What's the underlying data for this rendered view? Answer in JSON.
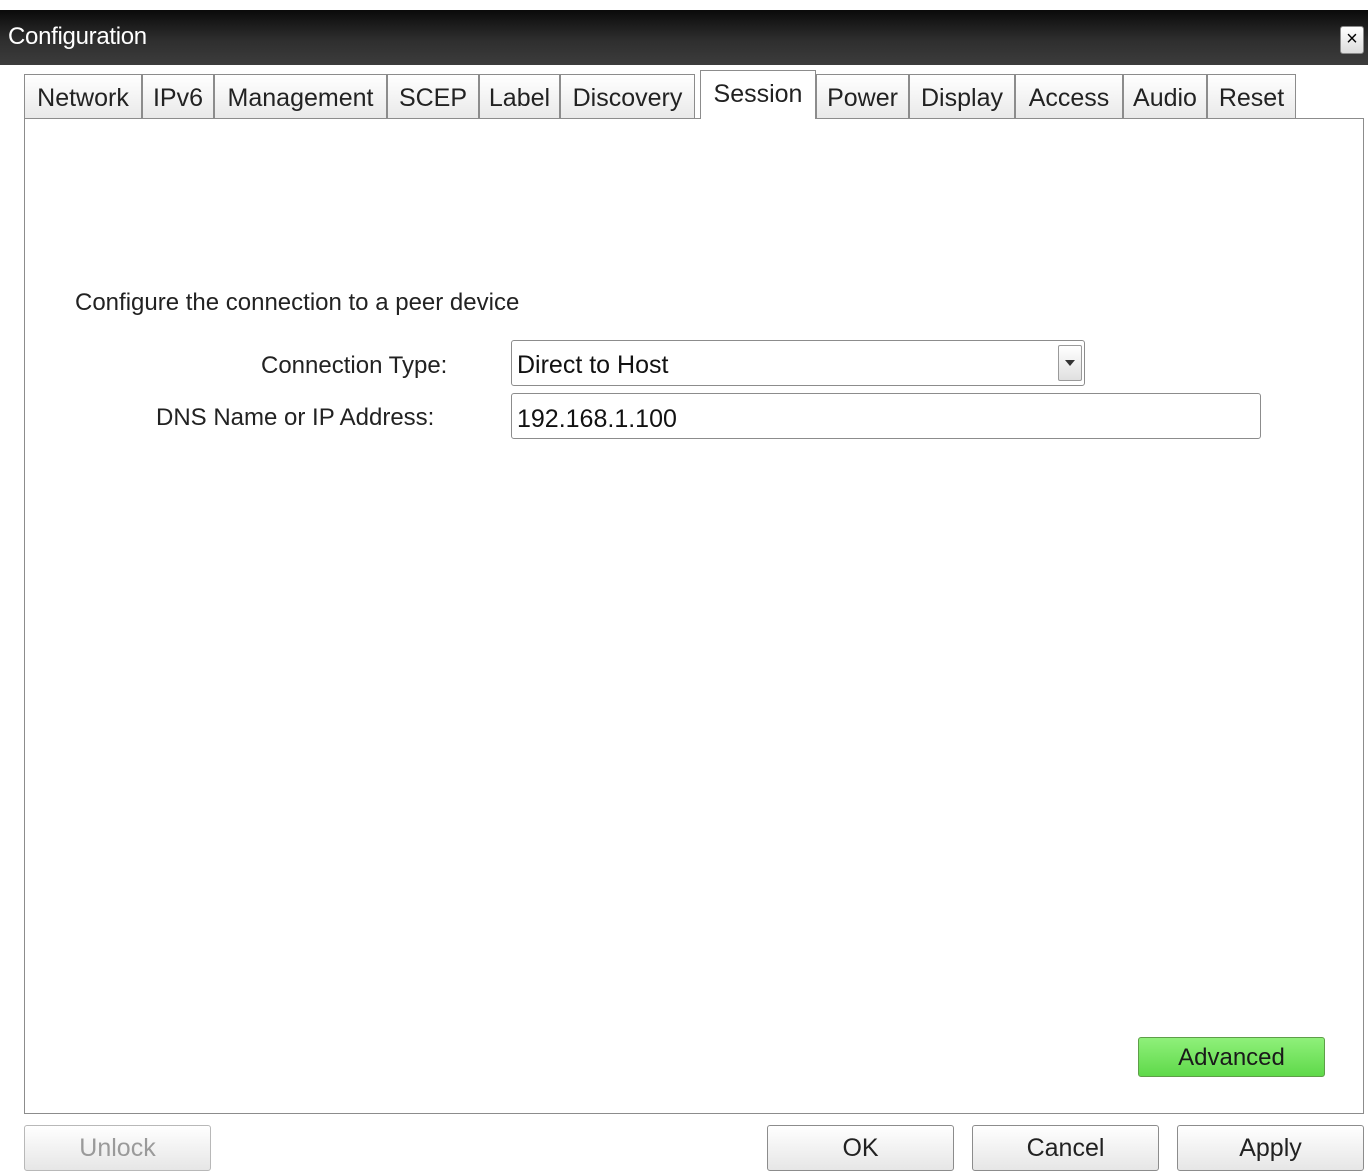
{
  "window": {
    "title": "Configuration",
    "close_symbol": "×",
    "close_icon": "close-icon"
  },
  "tabs": [
    {
      "label": "Network",
      "active": false
    },
    {
      "label": "IPv6",
      "active": false
    },
    {
      "label": "Management",
      "active": false
    },
    {
      "label": "SCEP",
      "active": false
    },
    {
      "label": "Label",
      "active": false
    },
    {
      "label": "Discovery",
      "active": false
    },
    {
      "label": "Session",
      "active": true
    },
    {
      "label": "Power",
      "active": false
    },
    {
      "label": "Display",
      "active": false
    },
    {
      "label": "Access",
      "active": false
    },
    {
      "label": "Audio",
      "active": false
    },
    {
      "label": "Reset",
      "active": false
    }
  ],
  "session": {
    "description": "Configure the connection to a peer device",
    "connection_type_label": "Connection Type:",
    "connection_type_value": "Direct to Host",
    "dns_label": "DNS Name or IP Address:",
    "dns_value": "192.168.1.100",
    "advanced_label": "Advanced",
    "advanced_color": "#6ee05a"
  },
  "footer": {
    "unlock_label": "Unlock",
    "ok_label": "OK",
    "cancel_label": "Cancel",
    "apply_label": "Apply"
  }
}
